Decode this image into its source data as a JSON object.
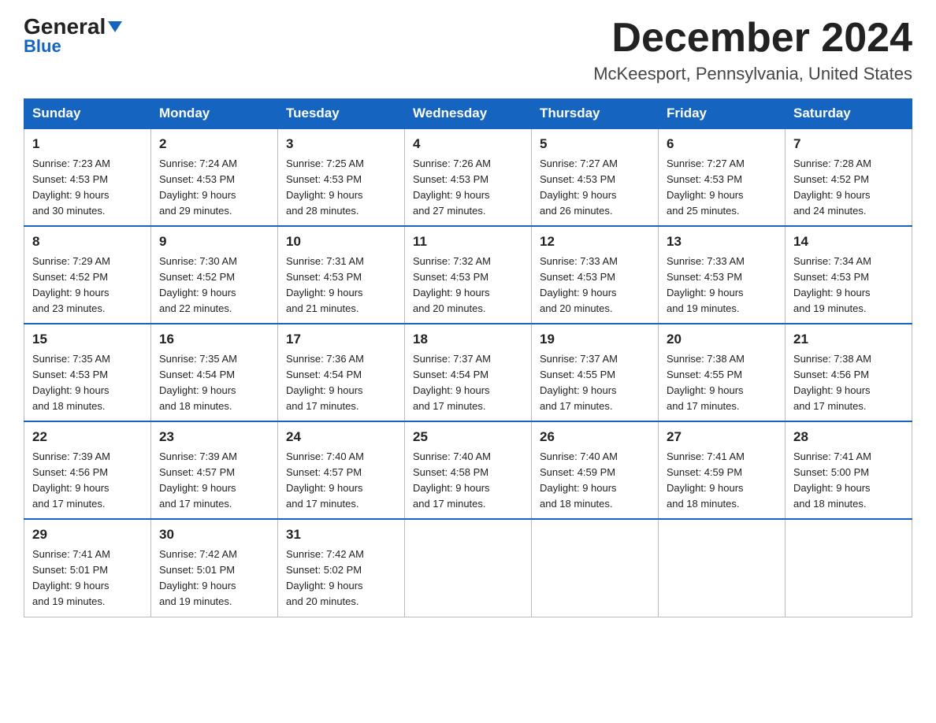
{
  "logo": {
    "general": "General",
    "blue": "Blue",
    "triangle": "▼"
  },
  "title": "December 2024",
  "location": "McKeesport, Pennsylvania, United States",
  "days_of_week": [
    "Sunday",
    "Monday",
    "Tuesday",
    "Wednesday",
    "Thursday",
    "Friday",
    "Saturday"
  ],
  "weeks": [
    [
      {
        "day": "1",
        "sunrise": "7:23 AM",
        "sunset": "4:53 PM",
        "daylight": "9 hours and 30 minutes."
      },
      {
        "day": "2",
        "sunrise": "7:24 AM",
        "sunset": "4:53 PM",
        "daylight": "9 hours and 29 minutes."
      },
      {
        "day": "3",
        "sunrise": "7:25 AM",
        "sunset": "4:53 PM",
        "daylight": "9 hours and 28 minutes."
      },
      {
        "day": "4",
        "sunrise": "7:26 AM",
        "sunset": "4:53 PM",
        "daylight": "9 hours and 27 minutes."
      },
      {
        "day": "5",
        "sunrise": "7:27 AM",
        "sunset": "4:53 PM",
        "daylight": "9 hours and 26 minutes."
      },
      {
        "day": "6",
        "sunrise": "7:27 AM",
        "sunset": "4:53 PM",
        "daylight": "9 hours and 25 minutes."
      },
      {
        "day": "7",
        "sunrise": "7:28 AM",
        "sunset": "4:52 PM",
        "daylight": "9 hours and 24 minutes."
      }
    ],
    [
      {
        "day": "8",
        "sunrise": "7:29 AM",
        "sunset": "4:52 PM",
        "daylight": "9 hours and 23 minutes."
      },
      {
        "day": "9",
        "sunrise": "7:30 AM",
        "sunset": "4:52 PM",
        "daylight": "9 hours and 22 minutes."
      },
      {
        "day": "10",
        "sunrise": "7:31 AM",
        "sunset": "4:53 PM",
        "daylight": "9 hours and 21 minutes."
      },
      {
        "day": "11",
        "sunrise": "7:32 AM",
        "sunset": "4:53 PM",
        "daylight": "9 hours and 20 minutes."
      },
      {
        "day": "12",
        "sunrise": "7:33 AM",
        "sunset": "4:53 PM",
        "daylight": "9 hours and 20 minutes."
      },
      {
        "day": "13",
        "sunrise": "7:33 AM",
        "sunset": "4:53 PM",
        "daylight": "9 hours and 19 minutes."
      },
      {
        "day": "14",
        "sunrise": "7:34 AM",
        "sunset": "4:53 PM",
        "daylight": "9 hours and 19 minutes."
      }
    ],
    [
      {
        "day": "15",
        "sunrise": "7:35 AM",
        "sunset": "4:53 PM",
        "daylight": "9 hours and 18 minutes."
      },
      {
        "day": "16",
        "sunrise": "7:35 AM",
        "sunset": "4:54 PM",
        "daylight": "9 hours and 18 minutes."
      },
      {
        "day": "17",
        "sunrise": "7:36 AM",
        "sunset": "4:54 PM",
        "daylight": "9 hours and 17 minutes."
      },
      {
        "day": "18",
        "sunrise": "7:37 AM",
        "sunset": "4:54 PM",
        "daylight": "9 hours and 17 minutes."
      },
      {
        "day": "19",
        "sunrise": "7:37 AM",
        "sunset": "4:55 PM",
        "daylight": "9 hours and 17 minutes."
      },
      {
        "day": "20",
        "sunrise": "7:38 AM",
        "sunset": "4:55 PM",
        "daylight": "9 hours and 17 minutes."
      },
      {
        "day": "21",
        "sunrise": "7:38 AM",
        "sunset": "4:56 PM",
        "daylight": "9 hours and 17 minutes."
      }
    ],
    [
      {
        "day": "22",
        "sunrise": "7:39 AM",
        "sunset": "4:56 PM",
        "daylight": "9 hours and 17 minutes."
      },
      {
        "day": "23",
        "sunrise": "7:39 AM",
        "sunset": "4:57 PM",
        "daylight": "9 hours and 17 minutes."
      },
      {
        "day": "24",
        "sunrise": "7:40 AM",
        "sunset": "4:57 PM",
        "daylight": "9 hours and 17 minutes."
      },
      {
        "day": "25",
        "sunrise": "7:40 AM",
        "sunset": "4:58 PM",
        "daylight": "9 hours and 17 minutes."
      },
      {
        "day": "26",
        "sunrise": "7:40 AM",
        "sunset": "4:59 PM",
        "daylight": "9 hours and 18 minutes."
      },
      {
        "day": "27",
        "sunrise": "7:41 AM",
        "sunset": "4:59 PM",
        "daylight": "9 hours and 18 minutes."
      },
      {
        "day": "28",
        "sunrise": "7:41 AM",
        "sunset": "5:00 PM",
        "daylight": "9 hours and 18 minutes."
      }
    ],
    [
      {
        "day": "29",
        "sunrise": "7:41 AM",
        "sunset": "5:01 PM",
        "daylight": "9 hours and 19 minutes."
      },
      {
        "day": "30",
        "sunrise": "7:42 AM",
        "sunset": "5:01 PM",
        "daylight": "9 hours and 19 minutes."
      },
      {
        "day": "31",
        "sunrise": "7:42 AM",
        "sunset": "5:02 PM",
        "daylight": "9 hours and 20 minutes."
      },
      null,
      null,
      null,
      null
    ]
  ],
  "labels": {
    "sunrise": "Sunrise:",
    "sunset": "Sunset:",
    "daylight": "Daylight:"
  }
}
